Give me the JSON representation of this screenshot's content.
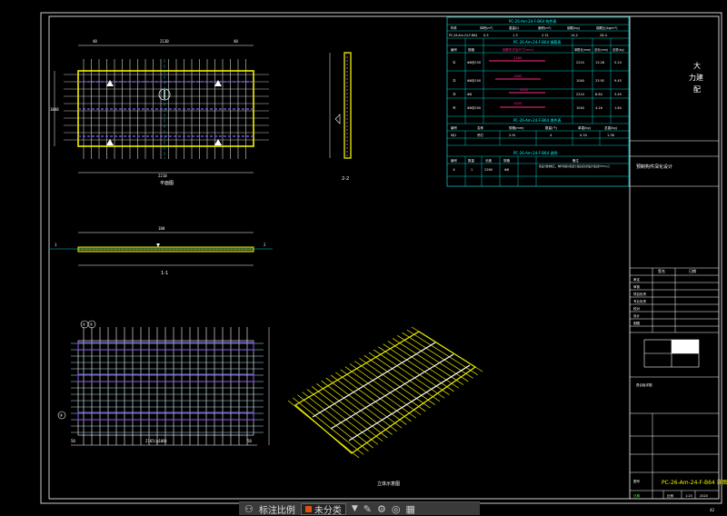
{
  "drawing": {
    "plan_title": "平面图",
    "section_1_title": "1-1",
    "section_2_title": "2-2",
    "iso_title": "立体示意图",
    "page_number": "42",
    "plan_dims_top": [
      "40",
      "2130",
      "40"
    ],
    "plan_dim_bottom": "2210",
    "plan_dim_left": "1040",
    "plan_dim_sec": "2210",
    "section_view_dim": "180",
    "section_view_label_left": "1",
    "section_view_label_right": "2",
    "rebar_dims_bottom": [
      "50",
      "2165(@100)",
      "50"
    ],
    "rebar_labels": [
      "①",
      "②",
      "③"
    ]
  },
  "table": {
    "title1": "PC-26-Am-24-F-B64 构件表",
    "header1": [
      "构件",
      "体积(m³)",
      "重量(t)",
      "面积(m²)",
      "钢筋(kg)",
      "钢筋比(kg/m³)"
    ],
    "row1": [
      "PC-26-Am-24-F-B64",
      "0.5",
      "1.3",
      "2.31",
      "14.2",
      "28.4"
    ],
    "title2": "PC-26-Am-24-F-B64 钢筋表",
    "header2": [
      "编号",
      "规格",
      "钢筋形式及尺寸(mm)",
      "单根长(mm)",
      "总长(mm)",
      "总重(kg)"
    ],
    "rows2": [
      [
        "①",
        "Φ8@150",
        "2260",
        "2210",
        "13.26",
        "5.24"
      ],
      [
        "②",
        "Φ8@100",
        "1080",
        "1040",
        "23.92",
        "9.45"
      ],
      [
        "③",
        "Φ8",
        "2210",
        "2210",
        "8.84",
        "3.49"
      ],
      [
        "④",
        "Φ8@200",
        "1040",
        "1040",
        "4.16",
        "1.64"
      ]
    ],
    "title3": "PC-26-Am-24-F-B64 埋件表",
    "header3": [
      "编号",
      "名称",
      "规格(mm)",
      "数量(个)",
      "单重(kg)",
      "总重(kg)"
    ],
    "rows3": [
      [
        "MJ1",
        "吊钉",
        "2.5t",
        "4",
        "0.34",
        "1.36"
      ]
    ],
    "title4": "PC-26-Am-24-F-B64 说明",
    "header4": [
      "编号",
      "数量",
      "长度",
      "规格",
      "备注"
    ],
    "rows4": [
      [
        "①",
        "1",
        "2260",
        "Φ8",
        "按设计要求施工，构件吊装时混凝土强度应达到设计强度的75%以上"
      ]
    ]
  },
  "title_block": {
    "company_line1": "大",
    "company_line2": "力建",
    "company_line3": "配",
    "project_name": "预制构件深化设计",
    "drawing_title": "叠合板详图",
    "row_labels": [
      "审定",
      "审核",
      "项目负责",
      "专业负责",
      "校对",
      "设计",
      "制图"
    ],
    "col_labels": [
      "签名",
      "日期"
    ],
    "field_labels": [
      "图号",
      "比例",
      "日期"
    ],
    "drawing_code": "PC-26-Am-24-F-B64 详图",
    "scale": "1:25",
    "date": "2020"
  },
  "status": {
    "icon_names": [
      "layers-icon",
      "snap-icon",
      "settings-icon",
      "palette-icon",
      "grid-icon"
    ],
    "annotate_label": "标注比例",
    "layer_name": "未分类",
    "dropdown": "▼"
  },
  "colors": {
    "background": "#000000",
    "slab": "#f0f000",
    "rebar": "#ffffff",
    "purple": "#8a5cff",
    "cyan": "#00ffff",
    "magenta": "#ff2a8a",
    "green": "#33ff33",
    "frame": "#ffffff"
  }
}
